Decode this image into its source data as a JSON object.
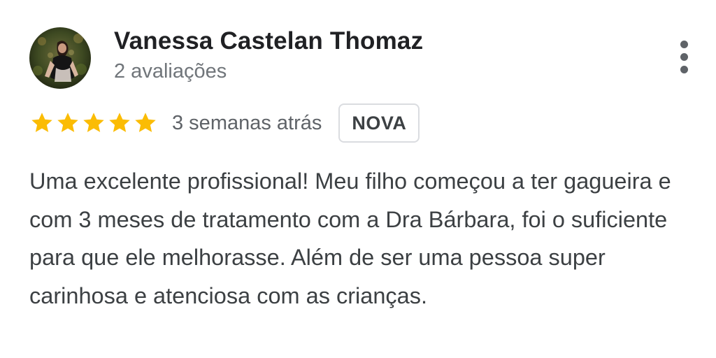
{
  "review": {
    "author_name": "Vanessa Castelan Thomaz",
    "review_count": "2 avaliações",
    "rating": 5,
    "rating_max": 5,
    "date": "3 semanas atrás",
    "badge": "NOVA",
    "text": "Uma excelente profissional! Meu filho começou a ter gagueira e com 3 meses de tratamento com a Dra Bárbara, foi o suficiente para que ele melhorasse. Além de ser uma pessoa super carinhosa e atenciosa com as crianças."
  },
  "icons": {
    "more": "more-vert-icon",
    "star": "star-icon"
  },
  "colors": {
    "star": "#fbbc04",
    "name": "#202124",
    "secondary": "#70757a",
    "text": "#3c4043",
    "badge_border": "#dadce0"
  }
}
